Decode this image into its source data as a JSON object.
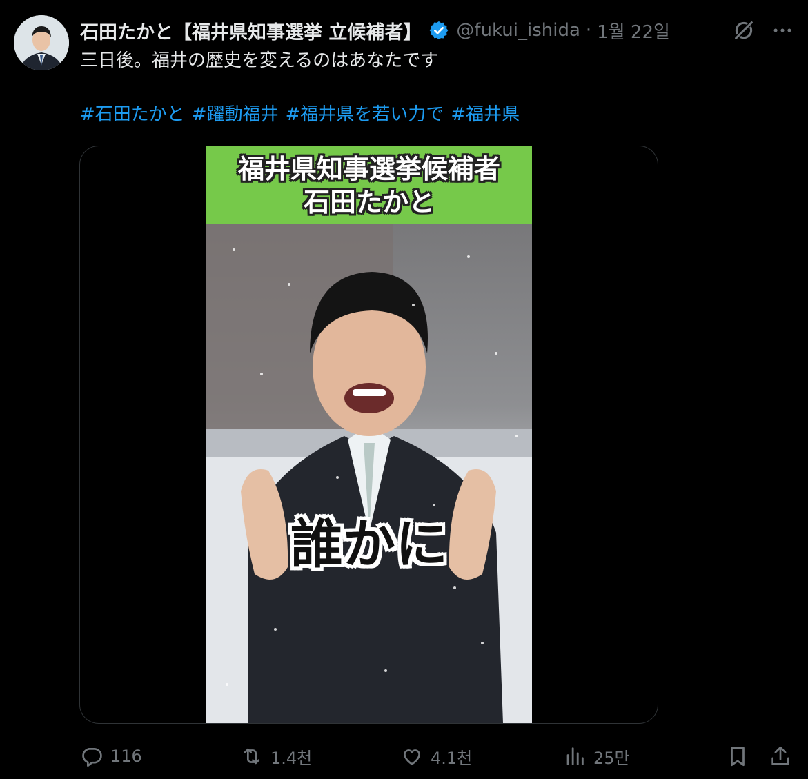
{
  "author": {
    "display_name": "石田たかと【福井県知事選挙 立候補者】",
    "handle": "@fukui_ishida",
    "separator": "·",
    "date": "1월 22일",
    "verified_icon": "verified-badge-icon"
  },
  "header_icons": [
    "grok-icon",
    "more-icon"
  ],
  "tweet": {
    "text": "三日後。福井の歴史を変えるのはあなたです",
    "hashtags": [
      "#石田たかと",
      "#躍動福井",
      "#福井県を若い力で",
      "#福井県"
    ]
  },
  "media": {
    "banner_line1": "福井県知事選挙候補者",
    "banner_line2": "石田たかと",
    "caption": "誰かに",
    "banner_color": "#76c94a"
  },
  "actions": {
    "replies": "116",
    "reposts": "1.4천",
    "likes": "4.1천",
    "views": "25만"
  },
  "colors": {
    "background": "#000000",
    "text": "#e7e9ea",
    "muted": "#71767b",
    "link": "#1d9bf0",
    "verified": "#1d9bf0"
  }
}
